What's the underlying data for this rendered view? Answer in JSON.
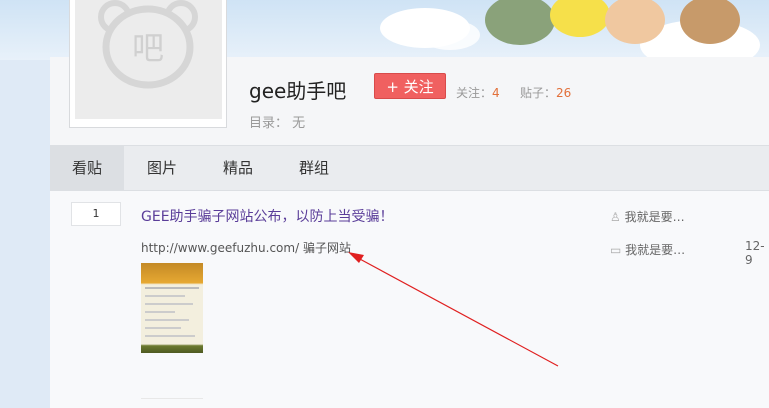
{
  "forum": {
    "name": "gee助手吧",
    "follow_label": "+ 关注",
    "follow_count_label": "关注：",
    "follow_count": "4",
    "post_count_label": "贴子：",
    "post_count": "26",
    "catalog_label": "目录：",
    "catalog_value": "无",
    "logo_char": "吧"
  },
  "tabs": [
    {
      "label": "看贴",
      "active": true
    },
    {
      "label": "图片",
      "active": false
    },
    {
      "label": "精品",
      "active": false
    },
    {
      "label": "群组",
      "active": false
    }
  ],
  "thread": {
    "reply_count": "1",
    "title": "GEE助手骗子网站公布，以防上当受骗！",
    "abstract": "http://www.geefuzhu.com/ 骗子网站",
    "author": "我就是要…",
    "last_reply_user": "我就是要…",
    "date": "12-9"
  },
  "colors": {
    "follow_button": "#f06060",
    "title_link": "#5a3d99",
    "stat_number": "#e2703a",
    "annotation_arrow": "#e02020"
  }
}
